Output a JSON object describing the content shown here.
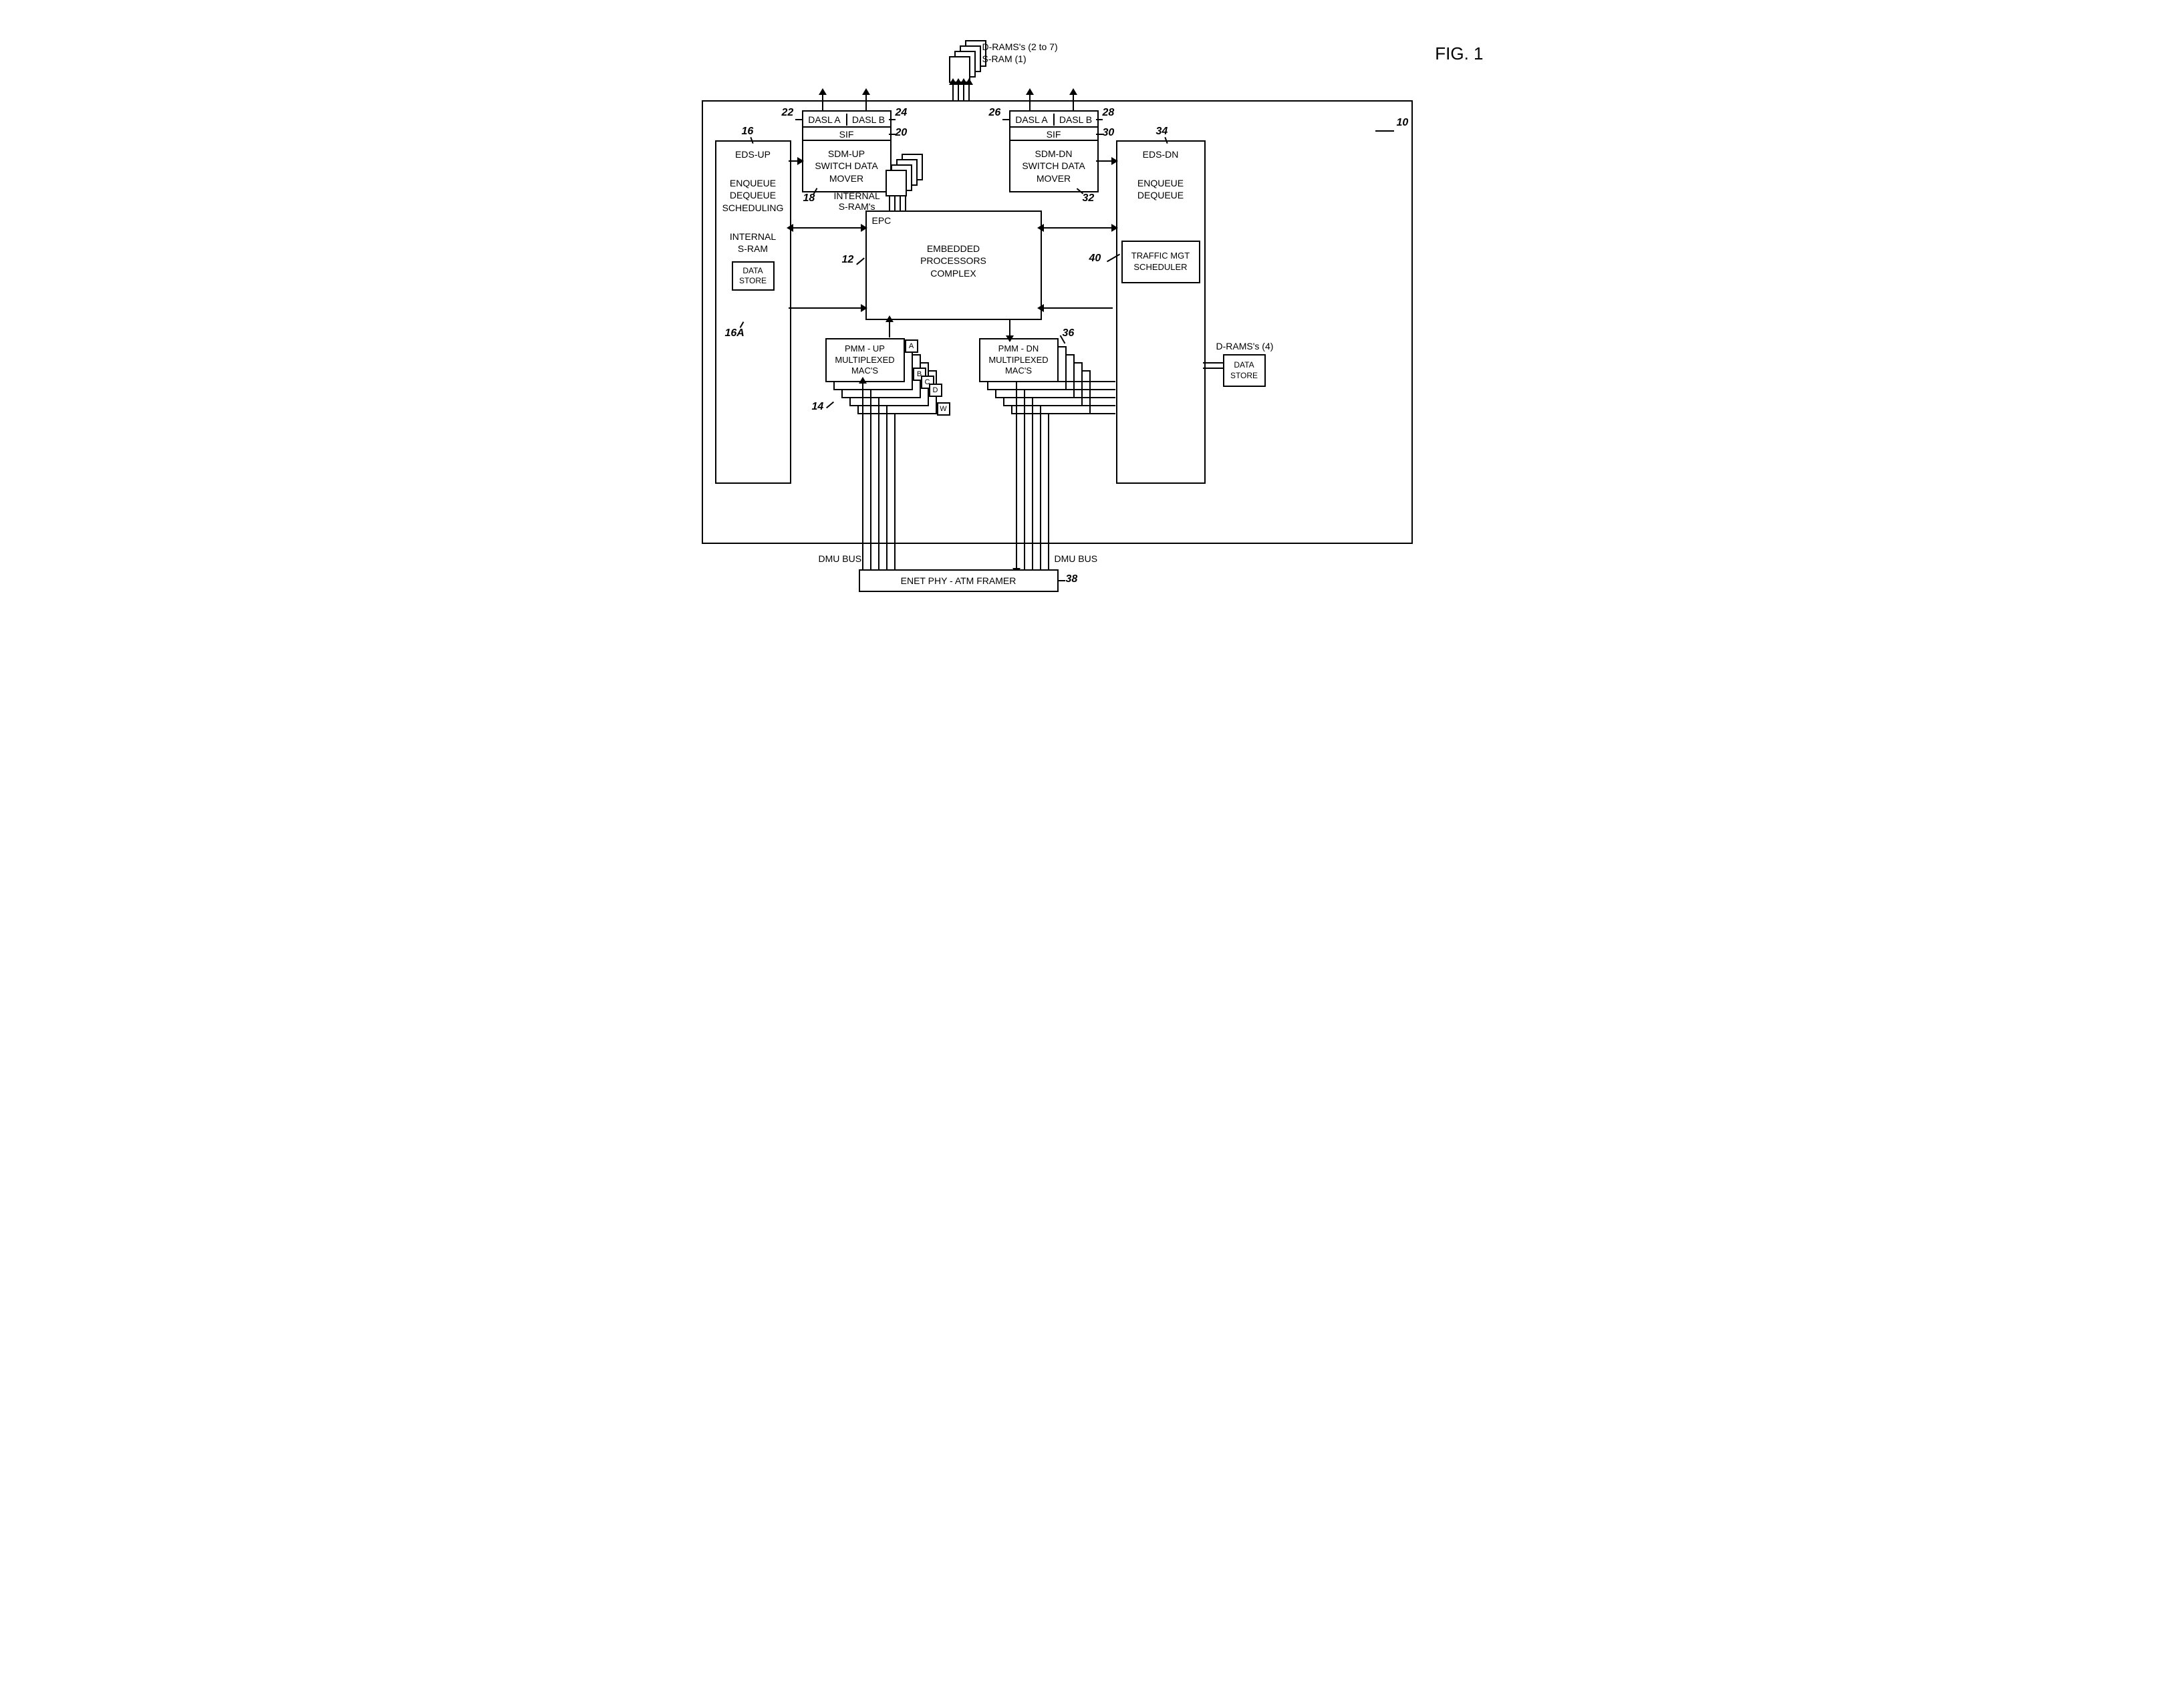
{
  "figTitle": "FIG. 1",
  "topMem": {
    "dram": "D-RAMS's (2 to 7)",
    "sram": "S-RAM (1)"
  },
  "dasl": {
    "a": "DASL A",
    "b": "DASL B"
  },
  "sif": "SIF",
  "sdmUp": {
    "title": "SDM-UP",
    "sub": "SWITCH DATA\nMOVER"
  },
  "sdmDn": {
    "title": "SDM-DN",
    "sub": "SWITCH DATA\nMOVER"
  },
  "edsUp": {
    "title": "EDS-UP",
    "sub": "ENQUEUE\nDEQUEUE\nSCHEDULING",
    "sram": "INTERNAL\nS-RAM",
    "store": "DATA\nSTORE"
  },
  "edsDn": {
    "title": "EDS-DN",
    "sub": "ENQUEUE\nDEQUEUE"
  },
  "internalSrams": "INTERNAL\nS-RAM's",
  "epc": {
    "tag": "EPC",
    "title": "EMBEDDED\nPROCESSORS\nCOMPLEX"
  },
  "traffic": "TRAFFIC MGT\nSCHEDULER",
  "pmmUp": {
    "title": "PMM - UP",
    "sub": "MULTIPLEXED\nMAC'S",
    "a": "A",
    "b": "B",
    "c": "C",
    "d": "D",
    "w": "W"
  },
  "pmmDn": {
    "title": "PMM - DN",
    "sub": "MULTIPLEXED\nMAC'S"
  },
  "dmuBus": "DMU BUS",
  "framer": "ENET PHY - ATM FRAMER",
  "rightMem": {
    "dram": "D-RAMS's (4)",
    "store": "DATA\nSTORE"
  },
  "refs": {
    "r10": "10",
    "r12": "12",
    "r14": "14",
    "r16": "16",
    "r16a": "16A",
    "r18": "18",
    "r20": "20",
    "r22": "22",
    "r24": "24",
    "r26": "26",
    "r28": "28",
    "r30": "30",
    "r32": "32",
    "r34": "34",
    "r36": "36",
    "r38": "38",
    "r40": "40"
  }
}
